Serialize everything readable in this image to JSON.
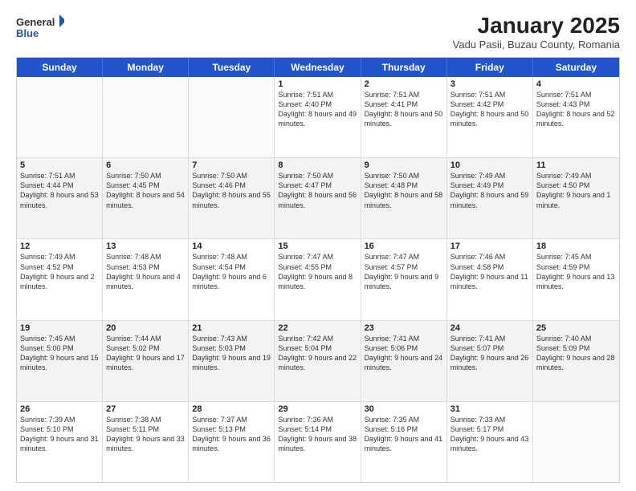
{
  "header": {
    "logo": {
      "general": "General",
      "blue": "Blue"
    },
    "title": "January 2025",
    "subtitle": "Vadu Pasii, Buzau County, Romania"
  },
  "calendar": {
    "days_of_week": [
      "Sunday",
      "Monday",
      "Tuesday",
      "Wednesday",
      "Thursday",
      "Friday",
      "Saturday"
    ],
    "weeks": [
      [
        {
          "day": "",
          "empty": true
        },
        {
          "day": "",
          "empty": true
        },
        {
          "day": "",
          "empty": true
        },
        {
          "day": "1",
          "rise": "7:51 AM",
          "set": "4:40 PM",
          "daylight": "8 hours and 49 minutes."
        },
        {
          "day": "2",
          "rise": "7:51 AM",
          "set": "4:41 PM",
          "daylight": "8 hours and 50 minutes."
        },
        {
          "day": "3",
          "rise": "7:51 AM",
          "set": "4:42 PM",
          "daylight": "8 hours and 50 minutes."
        },
        {
          "day": "4",
          "rise": "7:51 AM",
          "set": "4:43 PM",
          "daylight": "8 hours and 52 minutes."
        }
      ],
      [
        {
          "day": "5",
          "rise": "7:51 AM",
          "set": "4:44 PM",
          "daylight": "8 hours and 53 minutes."
        },
        {
          "day": "6",
          "rise": "7:50 AM",
          "set": "4:45 PM",
          "daylight": "8 hours and 54 minutes."
        },
        {
          "day": "7",
          "rise": "7:50 AM",
          "set": "4:46 PM",
          "daylight": "8 hours and 55 minutes."
        },
        {
          "day": "8",
          "rise": "7:50 AM",
          "set": "4:47 PM",
          "daylight": "8 hours and 56 minutes."
        },
        {
          "day": "9",
          "rise": "7:50 AM",
          "set": "4:48 PM",
          "daylight": "8 hours and 58 minutes."
        },
        {
          "day": "10",
          "rise": "7:49 AM",
          "set": "4:49 PM",
          "daylight": "8 hours and 59 minutes."
        },
        {
          "day": "11",
          "rise": "7:49 AM",
          "set": "4:50 PM",
          "daylight": "9 hours and 1 minute."
        }
      ],
      [
        {
          "day": "12",
          "rise": "7:49 AM",
          "set": "4:52 PM",
          "daylight": "9 hours and 2 minutes."
        },
        {
          "day": "13",
          "rise": "7:48 AM",
          "set": "4:53 PM",
          "daylight": "9 hours and 4 minutes."
        },
        {
          "day": "14",
          "rise": "7:48 AM",
          "set": "4:54 PM",
          "daylight": "9 hours and 6 minutes."
        },
        {
          "day": "15",
          "rise": "7:47 AM",
          "set": "4:55 PM",
          "daylight": "9 hours and 8 minutes."
        },
        {
          "day": "16",
          "rise": "7:47 AM",
          "set": "4:57 PM",
          "daylight": "9 hours and 9 minutes."
        },
        {
          "day": "17",
          "rise": "7:46 AM",
          "set": "4:58 PM",
          "daylight": "9 hours and 11 minutes."
        },
        {
          "day": "18",
          "rise": "7:45 AM",
          "set": "4:59 PM",
          "daylight": "9 hours and 13 minutes."
        }
      ],
      [
        {
          "day": "19",
          "rise": "7:45 AM",
          "set": "5:00 PM",
          "daylight": "9 hours and 15 minutes."
        },
        {
          "day": "20",
          "rise": "7:44 AM",
          "set": "5:02 PM",
          "daylight": "9 hours and 17 minutes."
        },
        {
          "day": "21",
          "rise": "7:43 AM",
          "set": "5:03 PM",
          "daylight": "9 hours and 19 minutes."
        },
        {
          "day": "22",
          "rise": "7:42 AM",
          "set": "5:04 PM",
          "daylight": "9 hours and 22 minutes."
        },
        {
          "day": "23",
          "rise": "7:41 AM",
          "set": "5:06 PM",
          "daylight": "9 hours and 24 minutes."
        },
        {
          "day": "24",
          "rise": "7:41 AM",
          "set": "5:07 PM",
          "daylight": "9 hours and 26 minutes."
        },
        {
          "day": "25",
          "rise": "7:40 AM",
          "set": "5:09 PM",
          "daylight": "9 hours and 28 minutes."
        }
      ],
      [
        {
          "day": "26",
          "rise": "7:39 AM",
          "set": "5:10 PM",
          "daylight": "9 hours and 31 minutes."
        },
        {
          "day": "27",
          "rise": "7:38 AM",
          "set": "5:11 PM",
          "daylight": "9 hours and 33 minutes."
        },
        {
          "day": "28",
          "rise": "7:37 AM",
          "set": "5:13 PM",
          "daylight": "9 hours and 36 minutes."
        },
        {
          "day": "29",
          "rise": "7:36 AM",
          "set": "5:14 PM",
          "daylight": "9 hours and 38 minutes."
        },
        {
          "day": "30",
          "rise": "7:35 AM",
          "set": "5:16 PM",
          "daylight": "9 hours and 41 minutes."
        },
        {
          "day": "31",
          "rise": "7:33 AM",
          "set": "5:17 PM",
          "daylight": "9 hours and 43 minutes."
        },
        {
          "day": "",
          "empty": true
        }
      ]
    ]
  }
}
